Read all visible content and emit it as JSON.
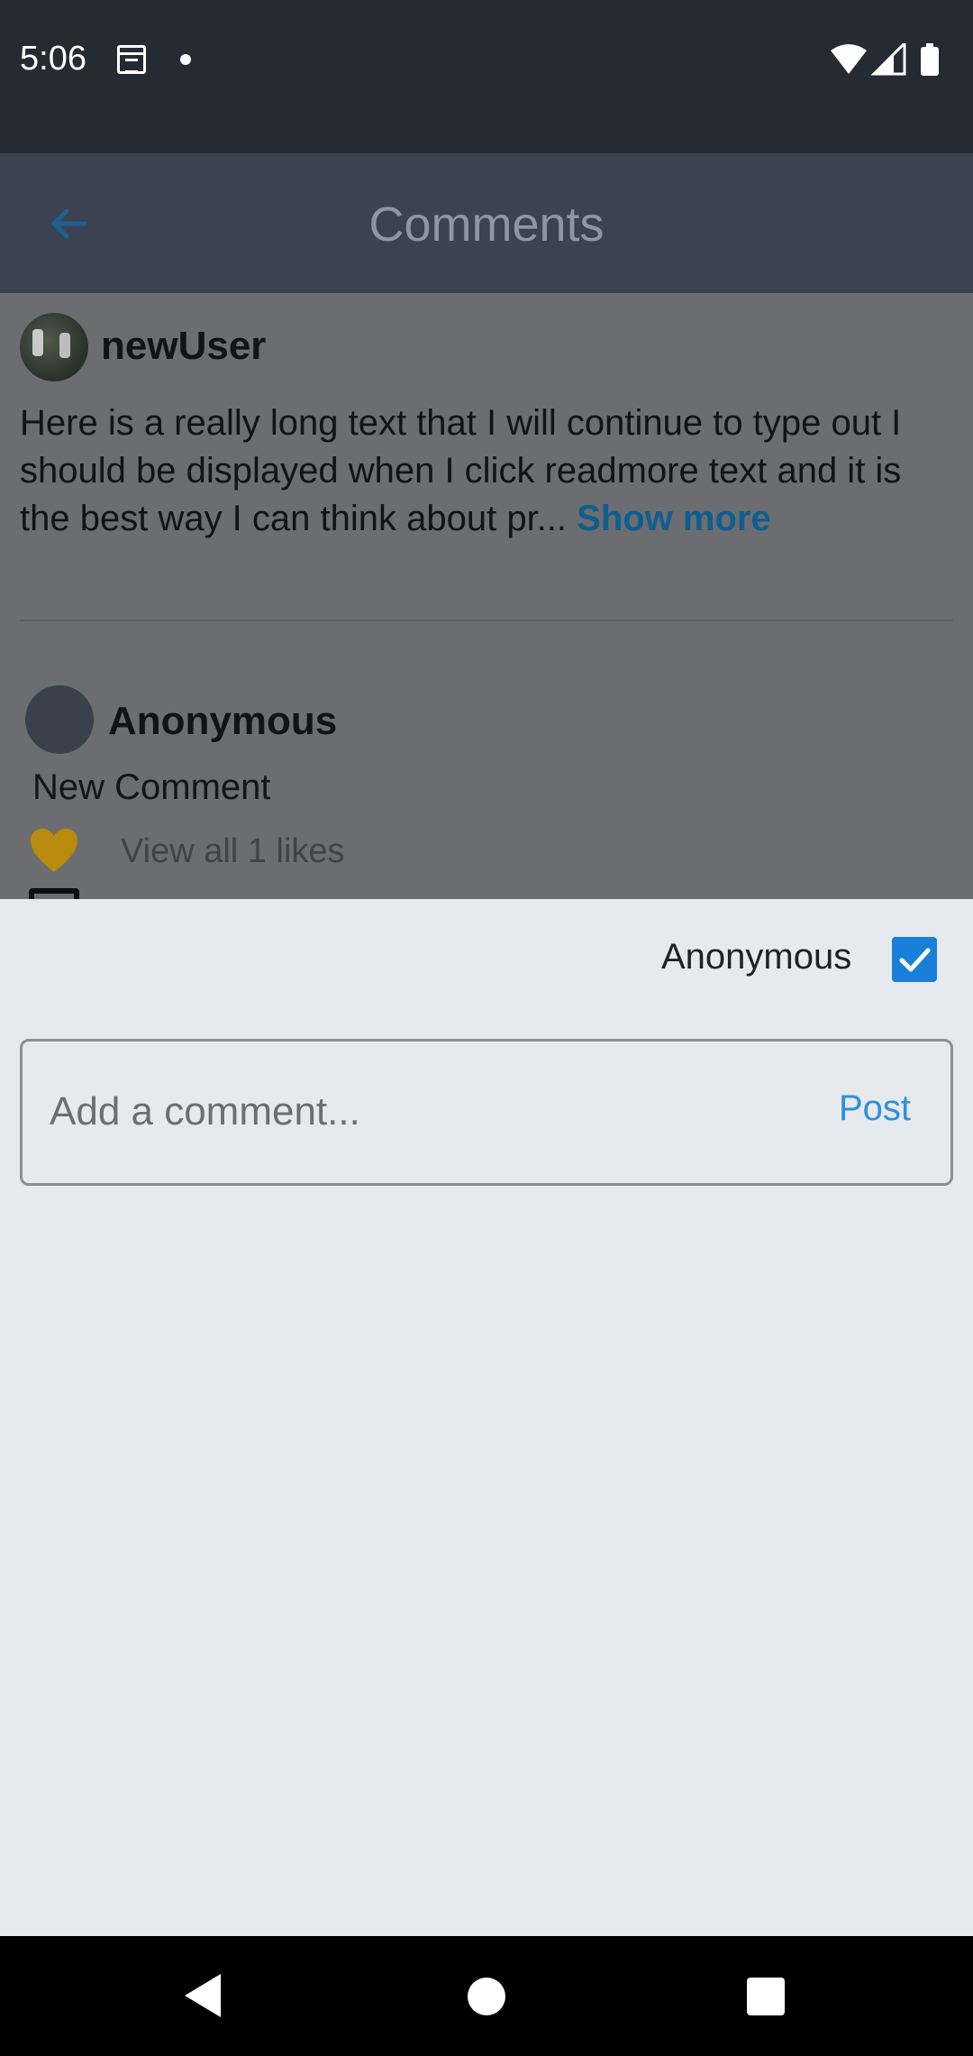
{
  "status_bar": {
    "time": "5:06",
    "icons": [
      "calendar-icon",
      "notification-dot-icon",
      "wifi-icon",
      "signal-icon",
      "battery-icon"
    ]
  },
  "header": {
    "title": "Comments",
    "back_icon": "arrow-left-icon"
  },
  "post": {
    "username": "newUser",
    "text": "Here is a really long text that I will continue to type out I should be displayed when I click readmore text and it is the best way I can think about pr... ",
    "show_more": "Show more"
  },
  "comments": [
    {
      "username": "Anonymous",
      "text": "New Comment",
      "likes_text": "View all 1 likes"
    }
  ],
  "composer": {
    "anonymous_label": "Anonymous",
    "anonymous_checked": true,
    "placeholder": "Add a comment...",
    "post_label": "Post"
  },
  "colors": {
    "accent": "#2e90da",
    "checkbox": "#1a7fd8",
    "heart": "#b88a0e",
    "status_bar": "#262a33"
  }
}
